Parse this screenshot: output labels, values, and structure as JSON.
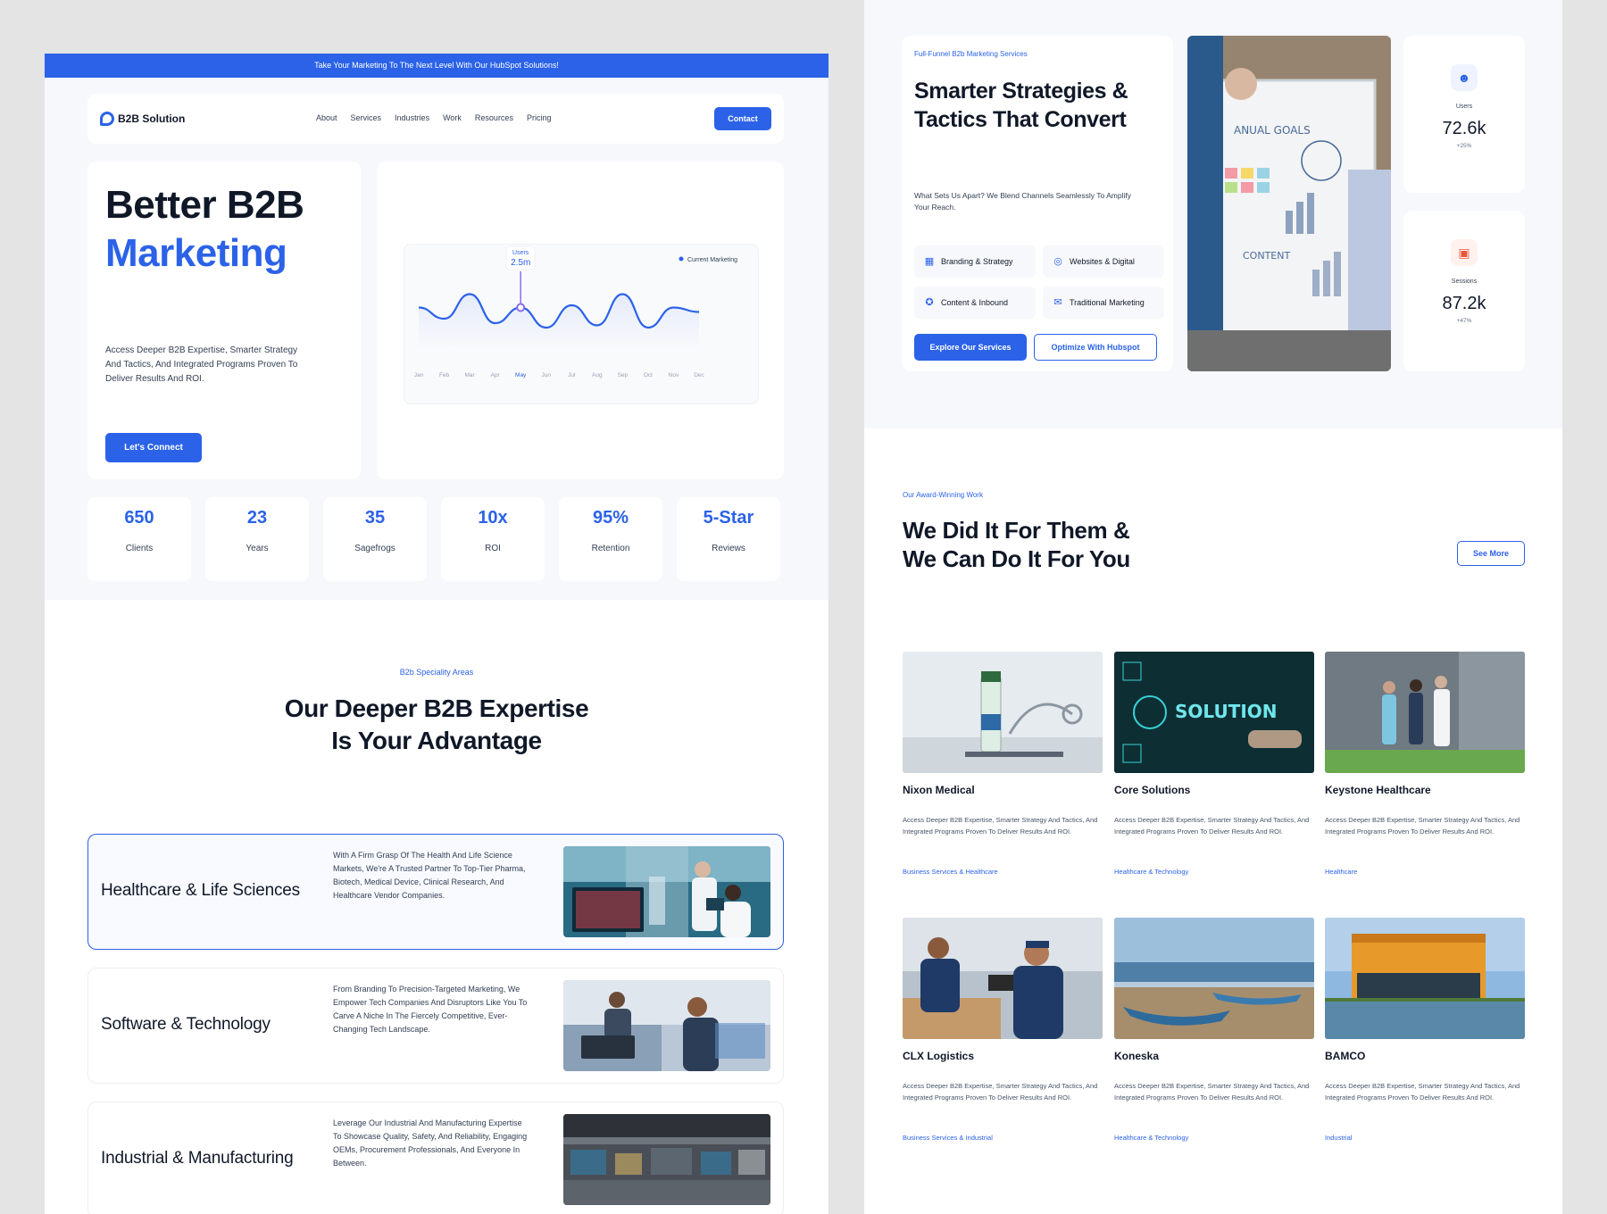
{
  "left": {
    "announcement": "Take Your Marketing To The Next Level With Our HubSpot Solutions!",
    "nav": {
      "logo": "B2B Solution",
      "links": [
        "About",
        "Services",
        "Industries",
        "Work",
        "Resources",
        "Pricing"
      ],
      "contact": "Contact"
    },
    "hero": {
      "title_line1": "Better B2B",
      "title_line2": "Marketing",
      "description": "Access Deeper B2B Expertise, Smarter Strategy And Tactics, And Integrated Programs Proven To Deliver Results And ROI.",
      "cta": "Let's Connect"
    },
    "chart_data": {
      "type": "line",
      "categories": [
        "Jan",
        "Feb",
        "Mar",
        "Apr",
        "May",
        "Jun",
        "Jul",
        "Aug",
        "Sep",
        "Oct",
        "Nov",
        "Dec"
      ],
      "legend_position": "top-right",
      "highlighted_category": "May",
      "series": [
        {
          "name": "Current Marketing",
          "color": "#2b62e8",
          "values": [
            0.55,
            0.3,
            0.85,
            0.2,
            0.55,
            0.1,
            0.6,
            0.15,
            0.85,
            0.1,
            0.55,
            0.45
          ]
        }
      ],
      "tooltip": {
        "label": "Users",
        "value": "2.5m"
      },
      "grid": false
    },
    "stats": [
      {
        "value": "650",
        "label": "Clients"
      },
      {
        "value": "23",
        "label": "Years"
      },
      {
        "value": "35",
        "label": "Sagefrogs"
      },
      {
        "value": "10x",
        "label": "ROI"
      },
      {
        "value": "95%",
        "label": "Retention"
      },
      {
        "value": "5-Star",
        "label": "Reviews"
      }
    ],
    "expertise": {
      "eyebrow": "B2b Speciality Areas",
      "title_line1": "Our Deeper B2B Expertise",
      "title_line2": "Is Your Advantage",
      "areas": [
        {
          "title": "Healthcare & Life Sciences",
          "description": "With A Firm Grasp Of The Health And Life Science Markets, We're A Trusted Partner To Top-Tier Pharma, Biotech, Medical Device, Clinical Research, And Healthcare Vendor Companies."
        },
        {
          "title": "Software & Technology",
          "description": "From Branding To Precision-Targeted Marketing, We Empower Tech Companies And Disruptors Like You To Carve A Niche In The Fiercely Competitive, Ever-Changing Tech Landscape."
        },
        {
          "title": "Industrial & Manufacturing",
          "description": "Leverage Our Industrial And Manufacturing Expertise To Showcase Quality, Safety, And Reliability, Engaging OEMs, Procurement Professionals, And Everyone In Between."
        }
      ]
    }
  },
  "right": {
    "services": {
      "eyebrow": "Full-Funnel B2b Marketing Services",
      "title_line1": "Smarter Strategies &",
      "title_line2": "Tactics That Convert",
      "description": "What Sets Us Apart? We Blend Channels Seamlessly To Amplify Your Reach.",
      "tags": [
        {
          "label": "Branding & Strategy",
          "icon": "layout-icon"
        },
        {
          "label": "Websites & Digital",
          "icon": "globe-icon"
        },
        {
          "label": "Content & Inbound",
          "icon": "badge-icon"
        },
        {
          "label": "Traditional Marketing",
          "icon": "megaphone-icon"
        }
      ],
      "primary_cta": "Explore Our Services",
      "secondary_cta": "Optimize With Hubspot",
      "board_text_1": "ANUAL GOALS",
      "board_text_2": "CONTENT"
    },
    "kpis": [
      {
        "label": "Users",
        "value": "72.6k",
        "change": "+25%",
        "icon": "users-icon",
        "color": "#2b62e8",
        "bg": "#eef3ff"
      },
      {
        "label": "Sessions",
        "value": "87.2k",
        "change": "+47%",
        "icon": "sessions-icon",
        "color": "#e8573a",
        "bg": "#fff1ee"
      }
    ],
    "work": {
      "eyebrow": "Our Award-Winning Work",
      "title_line1": "We Did It For Them &",
      "title_line2": "We Can Do It For You",
      "see_more": "See More",
      "solution_sign": "SOLUTION",
      "cases": [
        {
          "name": "Nixon Medical",
          "description": "Access Deeper B2B Expertise, Smarter Strategy And Tactics, And Integrated Programs Proven To Deliver Results And ROI.",
          "tag": "Business Services & Healthcare"
        },
        {
          "name": "Core Solutions",
          "description": "Access Deeper B2B Expertise, Smarter Strategy And Tactics, And Integrated Programs Proven To Deliver Results And ROI.",
          "tag": "Healthcare & Technology"
        },
        {
          "name": "Keystone Healthcare",
          "description": "Access Deeper B2B Expertise, Smarter Strategy And Tactics, And Integrated Programs Proven To Deliver Results And ROI.",
          "tag": "Healthcare"
        },
        {
          "name": "CLX Logistics",
          "description": "Access Deeper B2B Expertise, Smarter Strategy And Tactics, And Integrated Programs Proven To Deliver Results And ROI.",
          "tag": "Business Services & Industrial"
        },
        {
          "name": "Koneska",
          "description": "Access Deeper B2B Expertise, Smarter Strategy And Tactics, And Integrated Programs Proven To Deliver Results And ROI.",
          "tag": "Healthcare & Technology"
        },
        {
          "name": "BAMCO",
          "description": "Access Deeper B2B Expertise, Smarter Strategy And Tactics, And Integrated Programs Proven To Deliver Results And ROI.",
          "tag": "Industrial"
        }
      ]
    }
  }
}
